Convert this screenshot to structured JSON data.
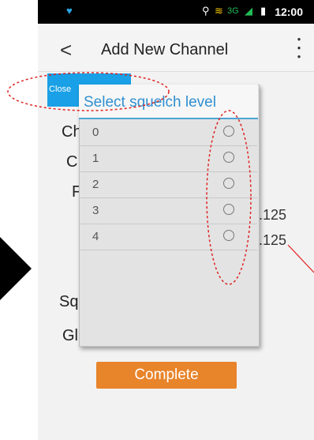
{
  "status_bar": {
    "time": "12:00",
    "network": "3G"
  },
  "header": {
    "back_glyph": "<",
    "title": "Add New Channel",
    "more_glyph": "⋮"
  },
  "close_button": {
    "label": "Close"
  },
  "background_form": {
    "labels": [
      "Ch",
      "C",
      "F",
      "Sq",
      "Gl"
    ],
    "values": [
      ".125",
      ".125"
    ]
  },
  "dialog": {
    "title": "Select squelch level",
    "options": [
      "0",
      "1",
      "2",
      "3",
      "4"
    ]
  },
  "complete_button": {
    "label": "Complete"
  },
  "colors": {
    "accent_blue": "#19a0e6",
    "complete_orange": "#e8842a",
    "annotation_red": "#e02020"
  }
}
